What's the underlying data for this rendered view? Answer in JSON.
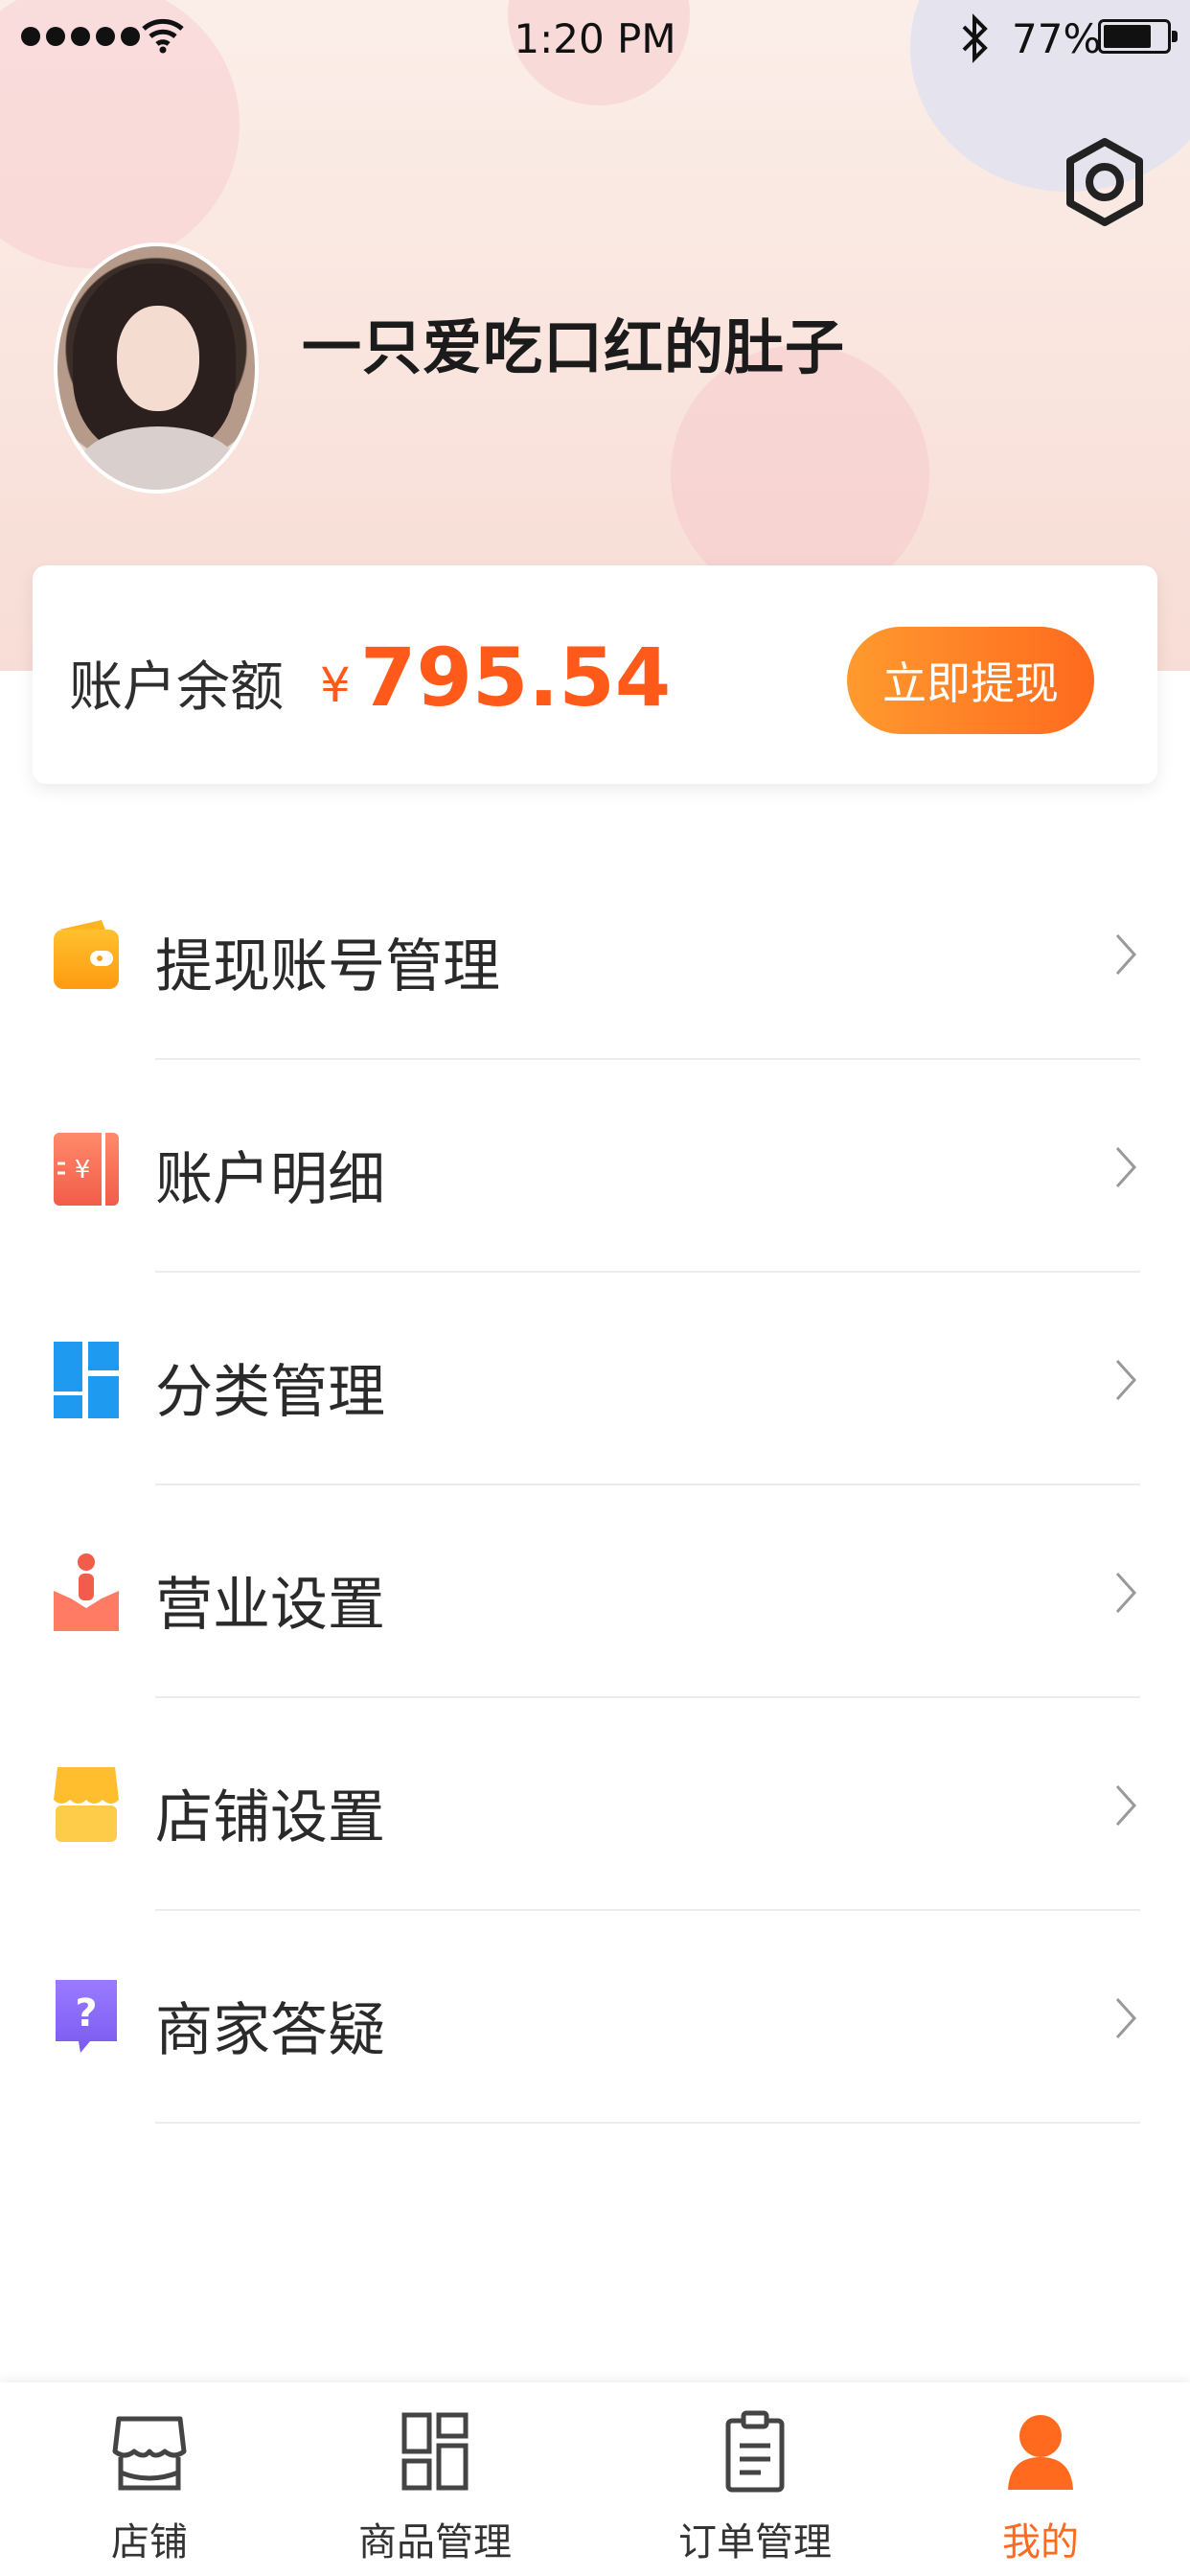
{
  "status_bar": {
    "time": "1:20 PM",
    "battery_percent": "77%",
    "battery_level": 0.77
  },
  "profile": {
    "username": "一只爱吃口红的肚子",
    "settings_icon": "hexagon-settings-icon",
    "avatar": "user-avatar-photo"
  },
  "balance": {
    "label": "账户余额",
    "currency": "¥",
    "amount": "795.54",
    "withdraw_button": "立即提现",
    "accent_color": "#ff5a1a"
  },
  "menu": {
    "items": [
      {
        "label": "提现账号管理",
        "icon": "wallet-icon"
      },
      {
        "label": "账户明细",
        "icon": "ticket-yuan-icon"
      },
      {
        "label": "分类管理",
        "icon": "grid-category-icon"
      },
      {
        "label": "营业设置",
        "icon": "business-person-icon"
      },
      {
        "label": "店铺设置",
        "icon": "store-awning-icon"
      },
      {
        "label": "商家答疑",
        "icon": "question-bubble-icon"
      }
    ]
  },
  "tabbar": {
    "tabs": [
      {
        "label": "店铺",
        "icon": "store-icon",
        "active": false
      },
      {
        "label": "商品管理",
        "icon": "products-grid-icon",
        "active": false
      },
      {
        "label": "订单管理",
        "icon": "clipboard-icon",
        "active": false
      },
      {
        "label": "我的",
        "icon": "person-icon",
        "active": true
      }
    ],
    "active_color": "#ff6a1e"
  }
}
